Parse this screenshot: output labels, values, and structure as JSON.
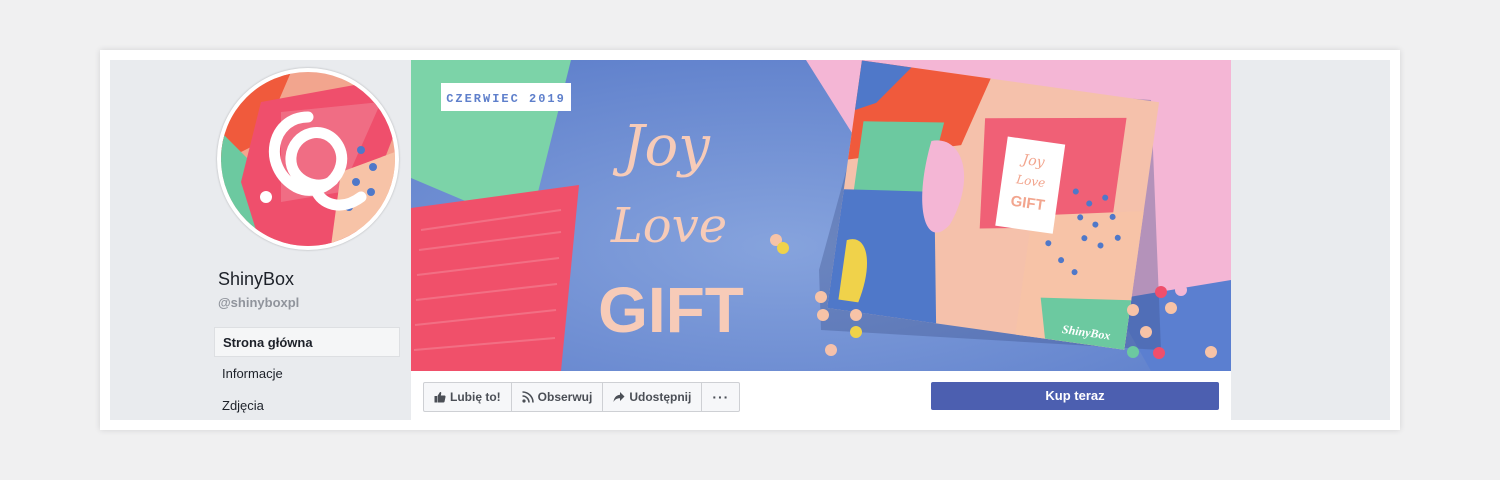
{
  "page": {
    "name": "ShinyBox",
    "handle": "@shinyboxpl"
  },
  "nav": {
    "items": [
      {
        "label": "Strona główna",
        "active": true
      },
      {
        "label": "Informacje",
        "active": false
      },
      {
        "label": "Zdjęcia",
        "active": false
      }
    ]
  },
  "cover": {
    "badge": "CZERWIEC 2019",
    "headline_1": "Joy",
    "headline_2": "Love",
    "headline_3": "GIFT",
    "box_label_1": "Joy",
    "box_label_2": "Love",
    "box_label_3": "GIFT",
    "box_brand": "ShinyBox"
  },
  "actions": {
    "like_label": "Lubię to!",
    "follow_label": "Obserwuj",
    "share_label": "Udostępnij",
    "more_label": "···",
    "buy_label": "Kup teraz"
  },
  "colors": {
    "accent": "#4c5fb0",
    "cover_blue": "#6b8cd4",
    "cover_pink": "#f4a7c4",
    "cover_coral": "#f0506a",
    "cover_mint": "#7cd3a8",
    "cover_peach": "#f7cbb8"
  },
  "icons": {
    "like": "thumbs-up-icon",
    "follow": "rss-icon",
    "share": "share-arrow-icon",
    "more": "more-dots-icon"
  }
}
